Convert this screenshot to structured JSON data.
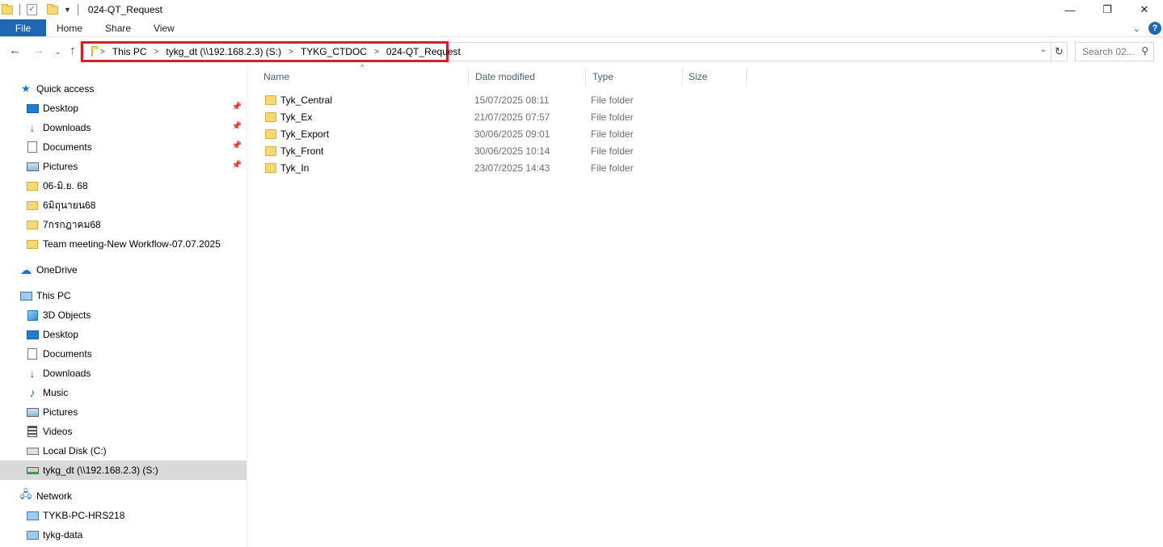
{
  "window": {
    "title": "024-QT_Request",
    "controls": {
      "minimize": "—",
      "maximize": "❐",
      "close": "✕"
    }
  },
  "ribbon": {
    "file_tab": "File",
    "tabs": [
      "Home",
      "Share",
      "View"
    ]
  },
  "address_bar": {
    "crumbs": [
      "This PC",
      "tykg_dt (\\\\192.168.2.3) (S:)",
      "TYKG_CTDOC",
      "024-QT_Request"
    ],
    "highlight_color": "#d0202a"
  },
  "search": {
    "placeholder": "Search 02..."
  },
  "sidebar": {
    "quick_access": {
      "label": "Quick access",
      "items": [
        {
          "label": "Desktop",
          "icon": "desktop-icon",
          "pinned": true
        },
        {
          "label": "Downloads",
          "icon": "download-icon",
          "pinned": true
        },
        {
          "label": "Documents",
          "icon": "document-icon",
          "pinned": true
        },
        {
          "label": "Pictures",
          "icon": "pictures-icon",
          "pinned": true
        },
        {
          "label": "06-มิ.ย. 68",
          "icon": "folder-icon",
          "pinned": false
        },
        {
          "label": "6มิถุนายน68",
          "icon": "folder-icon",
          "pinned": false
        },
        {
          "label": "7กรกฎาคม68",
          "icon": "folder-icon",
          "pinned": false
        },
        {
          "label": "Team meeting-New Workflow-07.07.2025",
          "icon": "folder-icon",
          "pinned": false
        }
      ]
    },
    "onedrive": {
      "label": "OneDrive"
    },
    "this_pc": {
      "label": "This PC",
      "items": [
        {
          "label": "3D Objects",
          "icon": "3d-objects-icon"
        },
        {
          "label": "Desktop",
          "icon": "desktop-icon"
        },
        {
          "label": "Documents",
          "icon": "document-icon"
        },
        {
          "label": "Downloads",
          "icon": "download-icon"
        },
        {
          "label": "Music",
          "icon": "music-icon"
        },
        {
          "label": "Pictures",
          "icon": "pictures-icon"
        },
        {
          "label": "Videos",
          "icon": "video-icon"
        },
        {
          "label": "Local Disk (C:)",
          "icon": "local-disk-icon"
        },
        {
          "label": "tykg_dt (\\\\192.168.2.3) (S:)",
          "icon": "network-drive-icon",
          "selected": true
        }
      ]
    },
    "network": {
      "label": "Network",
      "items": [
        {
          "label": "TYKB-PC-HRS218",
          "icon": "computer-icon"
        },
        {
          "label": "tykg-data",
          "icon": "computer-icon"
        }
      ]
    }
  },
  "file_list": {
    "columns": {
      "name": "Name",
      "date": "Date modified",
      "type": "Type",
      "size": "Size"
    },
    "rows": [
      {
        "name": "Tyk_Central",
        "date": "15/07/2025 08:11",
        "type": "File folder"
      },
      {
        "name": "Tyk_Ex",
        "date": "21/07/2025 07:57",
        "type": "File folder"
      },
      {
        "name": "Tyk_Export",
        "date": "30/06/2025 09:01",
        "type": "File folder"
      },
      {
        "name": "Tyk_Front",
        "date": "30/06/2025 10:14",
        "type": "File folder"
      },
      {
        "name": "Tyk_In",
        "date": "23/07/2025 14:43",
        "type": "File folder"
      }
    ]
  }
}
